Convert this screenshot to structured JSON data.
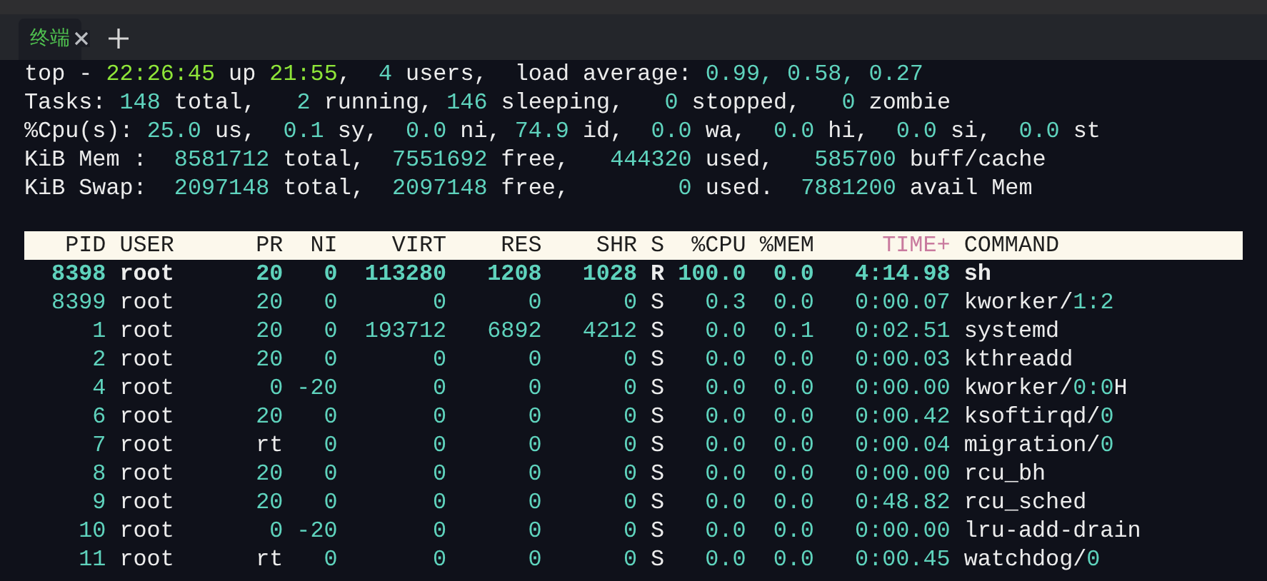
{
  "tabs": [
    {
      "label": "终端",
      "selected": true
    }
  ],
  "summary": [
    [
      {
        "text": "top - ",
        "kind": "label"
      },
      {
        "text": "22:26:45",
        "kind": "time"
      },
      {
        "text": " up ",
        "kind": "label"
      },
      {
        "text": "21:55",
        "kind": "time"
      },
      {
        "text": ",  ",
        "kind": "label"
      },
      {
        "text": "4",
        "kind": "value"
      },
      {
        "text": " users,  load average: ",
        "kind": "label"
      },
      {
        "text": "0.99, 0.58, 0.27",
        "kind": "value"
      }
    ],
    [
      {
        "text": "Tasks: ",
        "kind": "label"
      },
      {
        "text": "148",
        "kind": "value"
      },
      {
        "text": " total,   ",
        "kind": "label"
      },
      {
        "text": "2",
        "kind": "value"
      },
      {
        "text": " running, ",
        "kind": "label"
      },
      {
        "text": "146",
        "kind": "value"
      },
      {
        "text": " sleeping,   ",
        "kind": "label"
      },
      {
        "text": "0",
        "kind": "value"
      },
      {
        "text": " stopped,   ",
        "kind": "label"
      },
      {
        "text": "0",
        "kind": "value"
      },
      {
        "text": " zombie",
        "kind": "label"
      }
    ],
    [
      {
        "text": "%Cpu(s): ",
        "kind": "label"
      },
      {
        "text": "25.0",
        "kind": "value"
      },
      {
        "text": " us,  ",
        "kind": "label"
      },
      {
        "text": "0.1",
        "kind": "value"
      },
      {
        "text": " sy,  ",
        "kind": "label"
      },
      {
        "text": "0.0",
        "kind": "value"
      },
      {
        "text": " ni, ",
        "kind": "label"
      },
      {
        "text": "74.9",
        "kind": "value"
      },
      {
        "text": " id,  ",
        "kind": "label"
      },
      {
        "text": "0.0",
        "kind": "value"
      },
      {
        "text": " wa,  ",
        "kind": "label"
      },
      {
        "text": "0.0",
        "kind": "value"
      },
      {
        "text": " hi,  ",
        "kind": "label"
      },
      {
        "text": "0.0",
        "kind": "value"
      },
      {
        "text": " si,  ",
        "kind": "label"
      },
      {
        "text": "0.0",
        "kind": "value"
      },
      {
        "text": " st",
        "kind": "label"
      }
    ],
    [
      {
        "text": "KiB Mem :  ",
        "kind": "label"
      },
      {
        "text": "8581712",
        "kind": "value"
      },
      {
        "text": " total,  ",
        "kind": "label"
      },
      {
        "text": "7551692",
        "kind": "value"
      },
      {
        "text": " free,   ",
        "kind": "label"
      },
      {
        "text": "444320",
        "kind": "value"
      },
      {
        "text": " used,   ",
        "kind": "label"
      },
      {
        "text": "585700",
        "kind": "value"
      },
      {
        "text": " buff/cache",
        "kind": "label"
      }
    ],
    [
      {
        "text": "KiB Swap:  ",
        "kind": "label"
      },
      {
        "text": "2097148",
        "kind": "value"
      },
      {
        "text": " total,  ",
        "kind": "label"
      },
      {
        "text": "2097148",
        "kind": "value"
      },
      {
        "text": " free,        ",
        "kind": "label"
      },
      {
        "text": "0",
        "kind": "value"
      },
      {
        "text": " used.  ",
        "kind": "label"
      },
      {
        "text": "7881200",
        "kind": "value"
      },
      {
        "text": " avail Mem",
        "kind": "label"
      }
    ]
  ],
  "table": {
    "columns": [
      {
        "label": "PID",
        "sorted": false
      },
      {
        "label": "USER",
        "sorted": false
      },
      {
        "label": "PR",
        "sorted": false
      },
      {
        "label": "NI",
        "sorted": false
      },
      {
        "label": "VIRT",
        "sorted": false
      },
      {
        "label": "RES",
        "sorted": false
      },
      {
        "label": "SHR",
        "sorted": false
      },
      {
        "label": "S",
        "sorted": false
      },
      {
        "label": "%CPU",
        "sorted": false
      },
      {
        "label": "%MEM",
        "sorted": false
      },
      {
        "label": "TIME+",
        "sorted": true
      },
      {
        "label": "COMMAND",
        "sorted": false
      }
    ],
    "rows": [
      {
        "highlighted": true,
        "cells": [
          "8398",
          "root",
          "20",
          "0",
          "113280",
          "1208",
          "1028",
          "R",
          "100.0",
          "0.0",
          "4:14.98",
          "sh"
        ]
      },
      {
        "highlighted": false,
        "cells": [
          "8399",
          "root",
          "20",
          "0",
          "0",
          "0",
          "0",
          "S",
          "0.3",
          "0.0",
          "0:00.07",
          "kworker/1:2"
        ]
      },
      {
        "highlighted": false,
        "cells": [
          "1",
          "root",
          "20",
          "0",
          "193712",
          "6892",
          "4212",
          "S",
          "0.0",
          "0.1",
          "0:02.51",
          "systemd"
        ]
      },
      {
        "highlighted": false,
        "cells": [
          "2",
          "root",
          "20",
          "0",
          "0",
          "0",
          "0",
          "S",
          "0.0",
          "0.0",
          "0:00.03",
          "kthreadd"
        ]
      },
      {
        "highlighted": false,
        "cells": [
          "4",
          "root",
          "0",
          "-20",
          "0",
          "0",
          "0",
          "S",
          "0.0",
          "0.0",
          "0:00.00",
          "kworker/0:0H"
        ]
      },
      {
        "highlighted": false,
        "cells": [
          "6",
          "root",
          "20",
          "0",
          "0",
          "0",
          "0",
          "S",
          "0.0",
          "0.0",
          "0:00.42",
          "ksoftirqd/0"
        ]
      },
      {
        "highlighted": false,
        "cells": [
          "7",
          "root",
          "rt",
          "0",
          "0",
          "0",
          "0",
          "S",
          "0.0",
          "0.0",
          "0:00.04",
          "migration/0"
        ]
      },
      {
        "highlighted": false,
        "cells": [
          "8",
          "root",
          "20",
          "0",
          "0",
          "0",
          "0",
          "S",
          "0.0",
          "0.0",
          "0:00.00",
          "rcu_bh"
        ]
      },
      {
        "highlighted": false,
        "cells": [
          "9",
          "root",
          "20",
          "0",
          "0",
          "0",
          "0",
          "S",
          "0.0",
          "0.0",
          "0:48.82",
          "rcu_sched"
        ]
      },
      {
        "highlighted": false,
        "cells": [
          "10",
          "root",
          "0",
          "-20",
          "0",
          "0",
          "0",
          "S",
          "0.0",
          "0.0",
          "0:00.00",
          "lru-add-drain"
        ]
      },
      {
        "highlighted": false,
        "cells": [
          "11",
          "root",
          "rt",
          "0",
          "0",
          "0",
          "0",
          "S",
          "0.0",
          "0.0",
          "0:00.45",
          "watchdog/0"
        ]
      }
    ]
  }
}
